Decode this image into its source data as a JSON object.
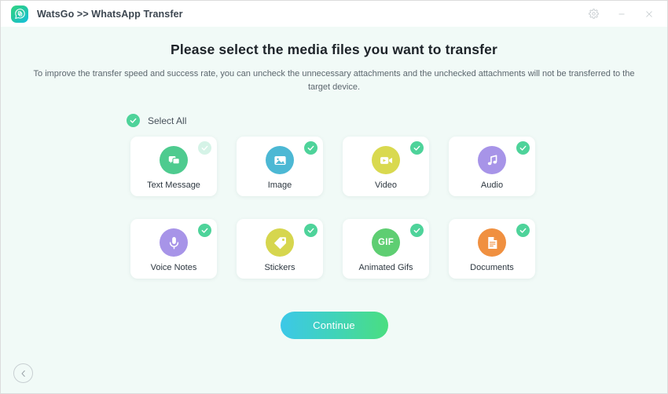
{
  "window": {
    "title": "WatsGo >> WhatsApp Transfer",
    "logo_icon": "watsgo-chat-logo",
    "controls": [
      {
        "name": "settings-button",
        "icon": "gear-icon"
      },
      {
        "name": "minimize-button",
        "icon": "minimize-icon"
      },
      {
        "name": "close-button",
        "icon": "close-icon"
      }
    ]
  },
  "page": {
    "headline": "Please select the media files you want to transfer",
    "subhead": "To improve the transfer speed and success rate, you can uncheck the unnecessary attachments and the unchecked attachments will not be transferred to the target device."
  },
  "select_all": {
    "label": "Select All",
    "checked": true,
    "icon": "check-circle-icon"
  },
  "cards": [
    {
      "label": "Text Message",
      "icon": "chat-bubbles-icon",
      "color": "#4ecb8f",
      "checked": true,
      "check_state": "locked"
    },
    {
      "label": "Image",
      "icon": "photo-icon",
      "color": "#4cb8d4",
      "checked": true,
      "check_state": "active"
    },
    {
      "label": "Video",
      "icon": "video-camera-icon",
      "color": "#d9d94f",
      "checked": true,
      "check_state": "active"
    },
    {
      "label": "Audio",
      "icon": "music-note-icon",
      "color": "#a794e8",
      "checked": true,
      "check_state": "active"
    },
    {
      "label": "Voice Notes",
      "icon": "microphone-icon",
      "color": "#a794e8",
      "checked": true,
      "check_state": "active"
    },
    {
      "label": "Stickers",
      "icon": "price-tag-icon",
      "color": "#d6d64e",
      "checked": true,
      "check_state": "active"
    },
    {
      "label": "Animated Gifs",
      "icon": "gif-text-icon",
      "color": "#5ece72",
      "checked": true,
      "check_state": "active",
      "glyph_text": "GIF"
    },
    {
      "label": "Documents",
      "icon": "document-icon",
      "color": "#f09040",
      "checked": true,
      "check_state": "active"
    }
  ],
  "actions": {
    "continue_label": "Continue",
    "back_icon": "chevron-left-icon"
  },
  "colors": {
    "page_background": "#f1faf7",
    "titlebar_background": "#ffffff",
    "card_background": "#ffffff",
    "check_active": "#4ed39a",
    "check_locked": "#d5f3e7",
    "continue_gradient_start": "#3cc8e8",
    "continue_gradient_end": "#4ade80",
    "headline_text": "#1d2329",
    "subhead_text": "#5c666e"
  }
}
